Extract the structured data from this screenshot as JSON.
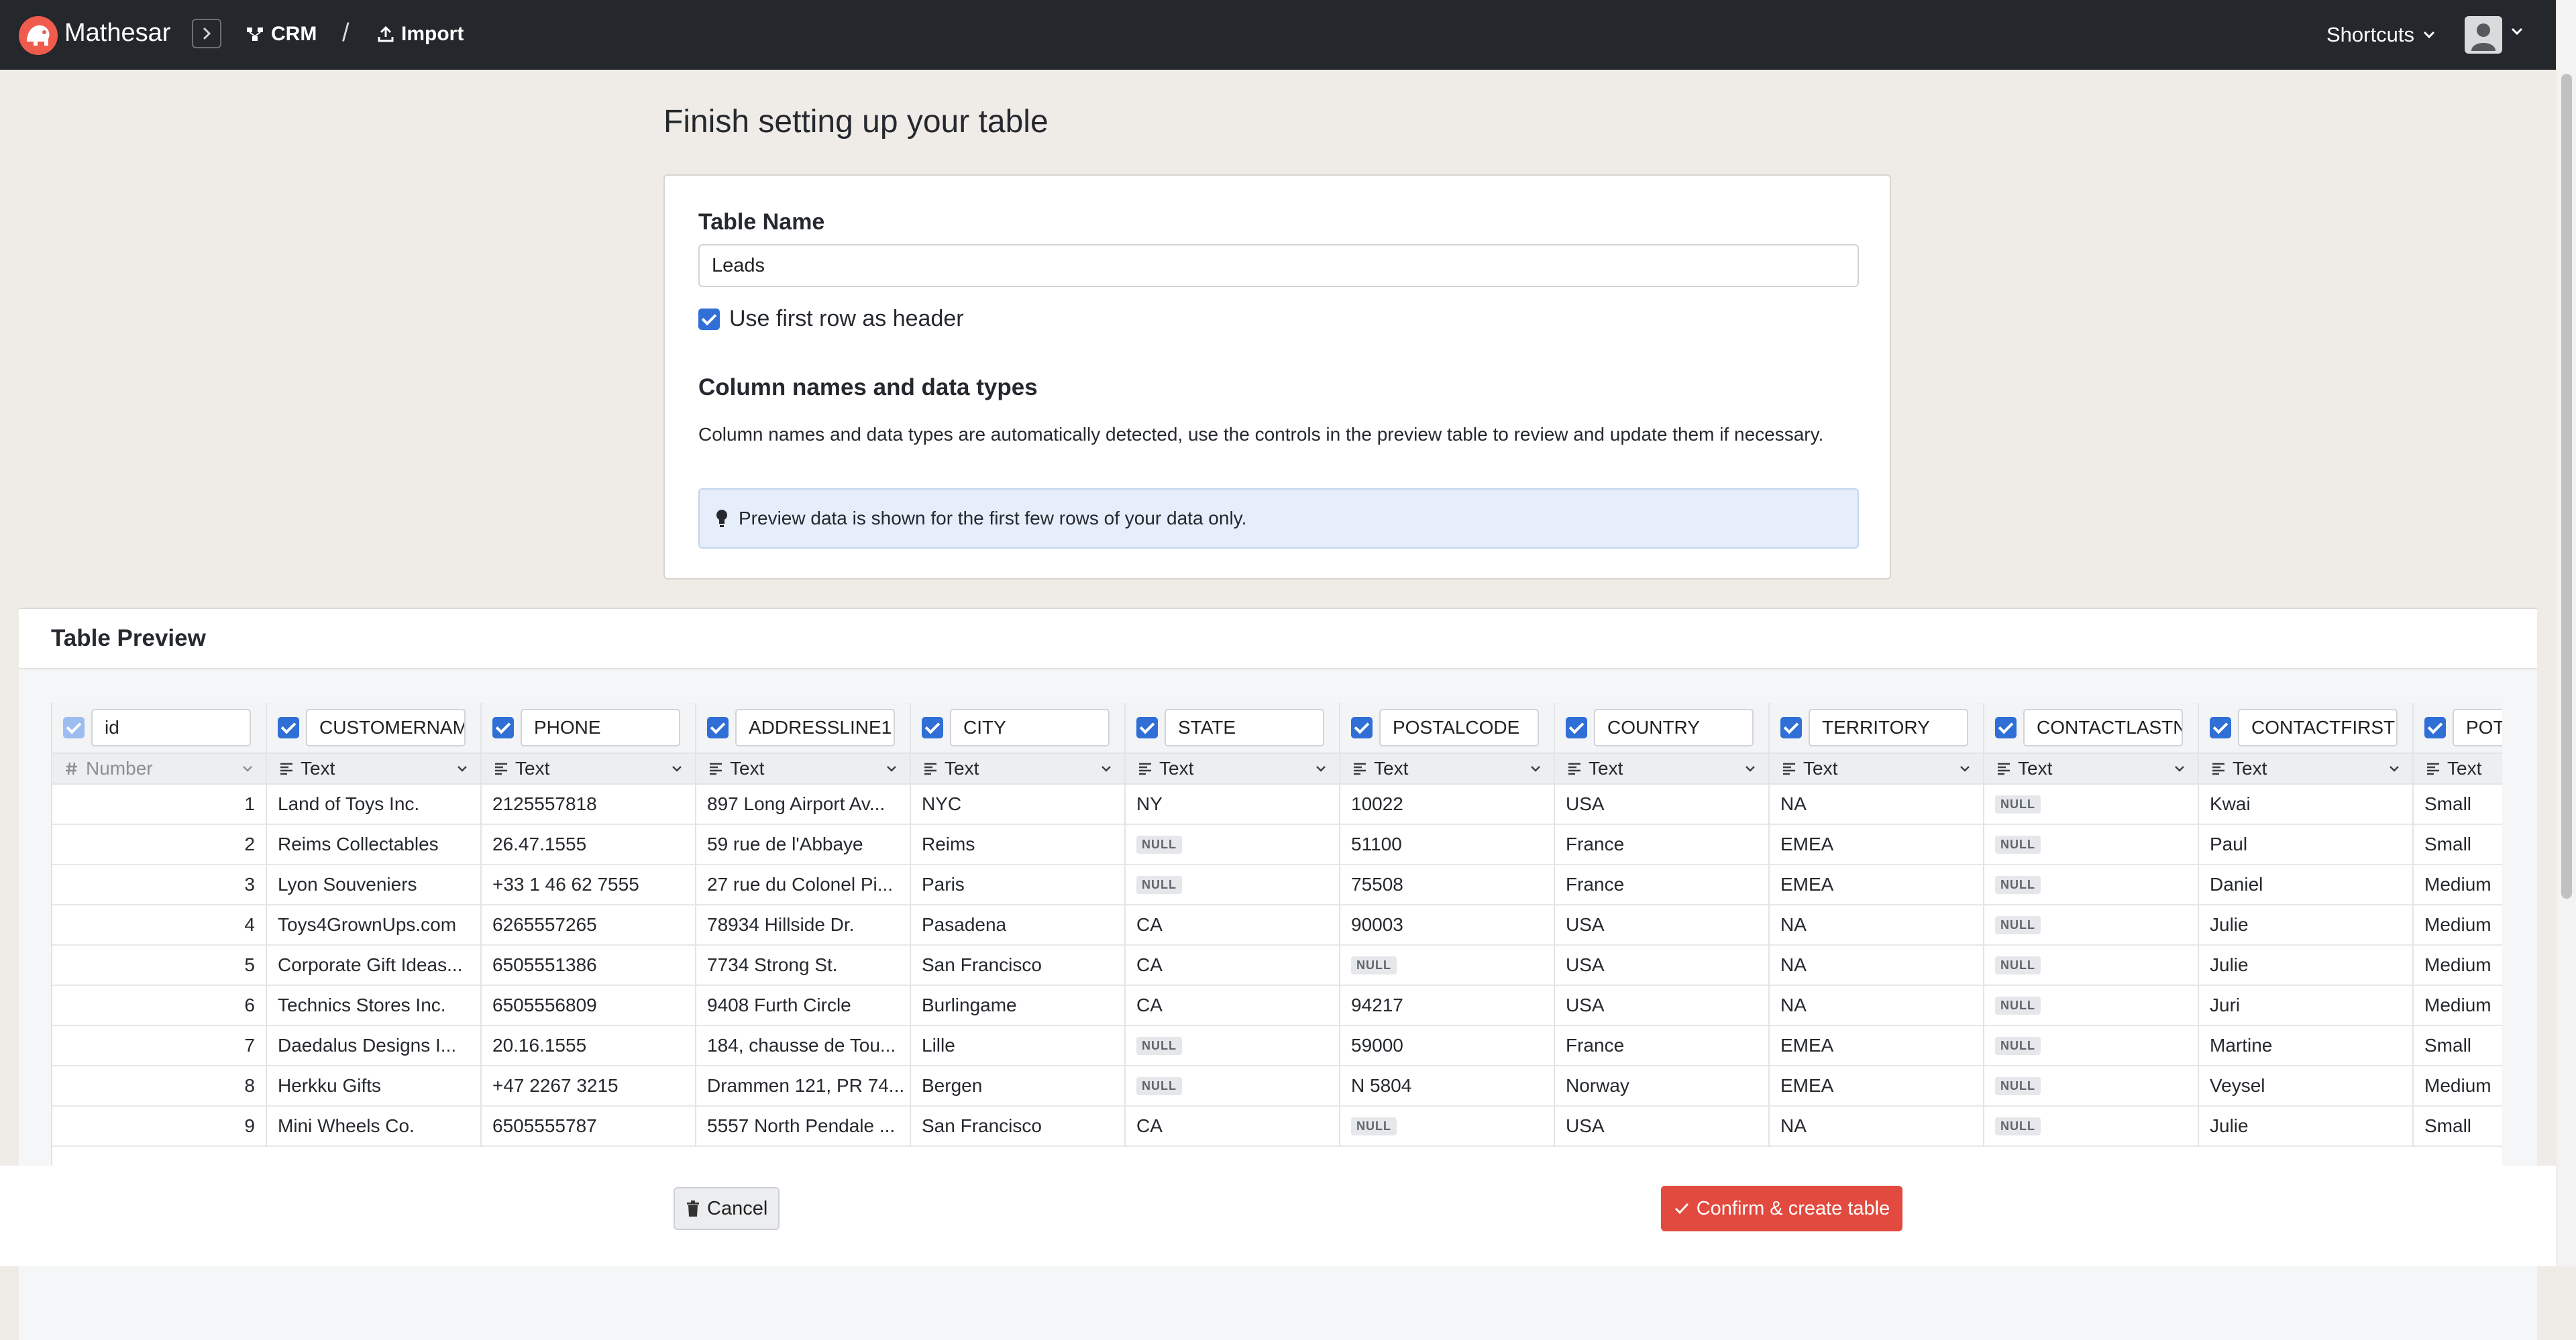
{
  "topbar": {
    "brand": "Mathesar",
    "breadcrumb_schema": "CRM",
    "breadcrumb_sep": "/",
    "breadcrumb_page": "Import",
    "shortcuts_label": "Shortcuts"
  },
  "page": {
    "title": "Finish setting up your table"
  },
  "form": {
    "table_name_label": "Table Name",
    "table_name_value": "Leads",
    "use_header_label": "Use first row as header",
    "column_section_title": "Column names and data types",
    "description": "Column names and data types are automatically detected, use the controls in the preview table to review and update them if necessary.",
    "info_note": "Preview data is shown for the first few rows of your data only."
  },
  "preview": {
    "title": "Table Preview",
    "null_label": "NULL",
    "columns": [
      {
        "name": "id",
        "type": "Number",
        "muted": true
      },
      {
        "name": "CUSTOMERNAME",
        "type": "Text"
      },
      {
        "name": "PHONE",
        "type": "Text"
      },
      {
        "name": "ADDRESSLINE1",
        "type": "Text"
      },
      {
        "name": "CITY",
        "type": "Text"
      },
      {
        "name": "STATE",
        "type": "Text"
      },
      {
        "name": "POSTALCODE",
        "type": "Text"
      },
      {
        "name": "COUNTRY",
        "type": "Text"
      },
      {
        "name": "TERRITORY",
        "type": "Text"
      },
      {
        "name": "CONTACTLASTNAME",
        "type": "Text"
      },
      {
        "name": "CONTACTFIRSTNAME",
        "type": "Text"
      },
      {
        "name": "POTENTIAL",
        "type": "Text"
      }
    ],
    "rows": [
      [
        "1",
        "Land of Toys Inc.",
        "2125557818",
        "897 Long Airport Av...",
        "NYC",
        "NY",
        "10022",
        "USA",
        "NA",
        null,
        "Kwai",
        "Small"
      ],
      [
        "2",
        "Reims Collectables",
        "26.47.1555",
        "59 rue de l'Abbaye",
        "Reims",
        null,
        "51100",
        "France",
        "EMEA",
        null,
        "Paul",
        "Small"
      ],
      [
        "3",
        "Lyon Souveniers",
        "+33 1 46 62 7555",
        "27 rue du Colonel Pi...",
        "Paris",
        null,
        "75508",
        "France",
        "EMEA",
        null,
        "Daniel",
        "Medium"
      ],
      [
        "4",
        "Toys4GrownUps.com",
        "6265557265",
        "78934 Hillside Dr.",
        "Pasadena",
        "CA",
        "90003",
        "USA",
        "NA",
        null,
        "Julie",
        "Medium"
      ],
      [
        "5",
        "Corporate Gift Ideas...",
        "6505551386",
        "7734 Strong St.",
        "San Francisco",
        "CA",
        null,
        "USA",
        "NA",
        null,
        "Julie",
        "Medium"
      ],
      [
        "6",
        "Technics Stores Inc.",
        "6505556809",
        "9408 Furth Circle",
        "Burlingame",
        "CA",
        "94217",
        "USA",
        "NA",
        null,
        "Juri",
        "Medium"
      ],
      [
        "7",
        "Daedalus Designs I...",
        "20.16.1555",
        "184, chausse de Tou...",
        "Lille",
        null,
        "59000",
        "France",
        "EMEA",
        null,
        "Martine",
        "Small"
      ],
      [
        "8",
        "Herkku Gifts",
        "+47 2267 3215",
        "Drammen 121, PR 74...",
        "Bergen",
        null,
        "N 5804",
        "Norway",
        "EMEA",
        null,
        "Veysel",
        "Medium"
      ],
      [
        "9",
        "Mini Wheels Co.",
        "6505555787",
        "5557 North Pendale ...",
        "San Francisco",
        "CA",
        null,
        "USA",
        "NA",
        null,
        "Julie",
        "Small"
      ]
    ]
  },
  "footer": {
    "cancel_label": "Cancel",
    "confirm_label": "Confirm & create table"
  },
  "colors": {
    "topbar": "#24272b",
    "accent_blue": "#2f6fd6",
    "confirm_red": "#e24a3f",
    "info_bg": "#e7eefb"
  },
  "icons": {
    "logo": "mathesar-elephant-logo",
    "sidebar_toggle": "chevron-right-icon",
    "schema": "schema-nodes-icon",
    "import": "upload-icon",
    "dropdown": "chevron-down-icon",
    "user": "user-icon",
    "hint": "lightbulb-icon",
    "number_type": "hash-icon",
    "text_type": "text-lines-icon",
    "cancel": "trash-icon",
    "confirm": "check-icon"
  }
}
